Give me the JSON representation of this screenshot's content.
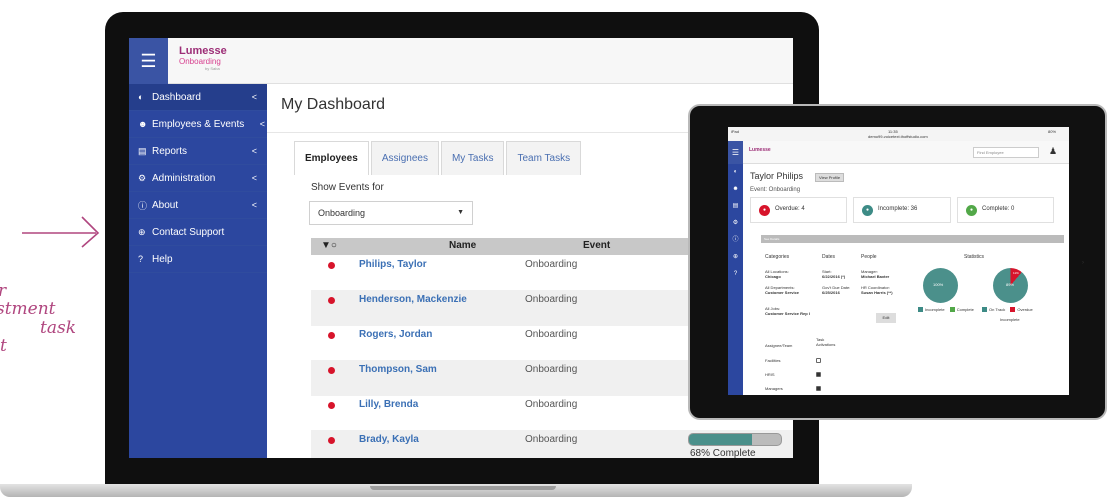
{
  "annotation": {
    "lines": [
      "r",
      "stment",
      "task",
      "t"
    ]
  },
  "app": {
    "logo_main": "Lumesse",
    "logo_sub": "Onboarding",
    "logo_tag": "by Saba",
    "page_title": "My Dashboard"
  },
  "sidebar": {
    "items": [
      {
        "icon": "dashboard-icon",
        "glyph": "◐",
        "label": "Dashboard",
        "chevron": "<"
      },
      {
        "icon": "people-icon",
        "glyph": "☻",
        "label": "Employees & Events",
        "chevron": "<"
      },
      {
        "icon": "reports-icon",
        "glyph": "▤",
        "label": "Reports",
        "chevron": "<"
      },
      {
        "icon": "gear-icon",
        "glyph": "⚙",
        "label": "Administration",
        "chevron": "<"
      },
      {
        "icon": "info-icon",
        "glyph": "ⓘ",
        "label": "About",
        "chevron": "<"
      },
      {
        "icon": "support-icon",
        "glyph": "⊕",
        "label": "Contact Support",
        "chevron": ""
      },
      {
        "icon": "help-icon",
        "glyph": "?",
        "label": "Help",
        "chevron": ""
      }
    ]
  },
  "tabs": [
    {
      "label": "Employees",
      "active": true
    },
    {
      "label": "Assignees",
      "active": false
    },
    {
      "label": "My Tasks",
      "active": false
    },
    {
      "label": "Team Tasks",
      "active": false
    }
  ],
  "filter": {
    "label": "Show Events for",
    "value": "Onboarding"
  },
  "grid": {
    "sort_glyph": "▼○",
    "col_name": "Name",
    "col_event": "Event",
    "rows": [
      {
        "name": "Philips, Taylor",
        "event": "Onboarding"
      },
      {
        "name": "Henderson, Mackenzie",
        "event": "Onboarding"
      },
      {
        "name": "Rogers, Jordan",
        "event": "Onboarding"
      },
      {
        "name": "Thompson, Sam",
        "event": "Onboarding"
      },
      {
        "name": "Lilly, Brenda",
        "event": "Onboarding"
      },
      {
        "name": "Brady, Kayla",
        "event": "Onboarding"
      }
    ],
    "progress_value": 0.68,
    "progress_label": "68% Complete"
  },
  "tablet": {
    "status_left": "iPad",
    "status_time": "11:35",
    "status_url": "demo99-voicetext.thoffstudio.com",
    "status_battery": "80%",
    "search_placeholder": "Find Employee",
    "title": "Taylor Philips",
    "view_profile": "View Profile",
    "event": "Event: Onboarding",
    "cards": [
      {
        "label": "Overdue: 4",
        "color": "#d7142b"
      },
      {
        "label": "Incomplete: 36",
        "color": "#3d8b86"
      },
      {
        "label": "Complete: 0",
        "color": "#52a848"
      }
    ],
    "section": "See Details",
    "col_categories": "Categories",
    "col_dates": "Dates",
    "col_people": "People",
    "col_statistics": "Statistics",
    "locations_label": "All Locations:",
    "locations_value": "Chicago",
    "departments_label": "All Departments:",
    "departments_value": "Customer Service",
    "jobs_label": "All Jobs:",
    "jobs_value": "Customer Service Rep I",
    "start_label": "Start:",
    "start_value": "6/22/2016 (*)",
    "govt_label": "Gov't Due Date:",
    "govt_value": "6/25/2016",
    "manager_label": "Manager:",
    "manager_value": "Michael Baxter",
    "hr_label": "HR Coordinator:",
    "hr_value": "Susan Harris (**)",
    "edit": "Edit",
    "pie1_label": "100%",
    "pie2_label": "89%",
    "pie2_small": "11%",
    "legend1": [
      {
        "label": "Incomplete",
        "color": "#3d8b86"
      },
      {
        "label": "Complete",
        "color": "#52a848"
      }
    ],
    "legend2": [
      {
        "label": "On Track",
        "color": "#3d8b86"
      },
      {
        "label": "Overdue",
        "color": "#d7142b"
      }
    ],
    "pie2_caption": "Incomplete",
    "assign_header": "Assignee/Team",
    "task_header": "Task Activations",
    "assignees": [
      {
        "name": "Facilities",
        "checked": false
      },
      {
        "name": "HRIS",
        "checked": true
      },
      {
        "name": "Managers",
        "checked": true
      }
    ]
  }
}
